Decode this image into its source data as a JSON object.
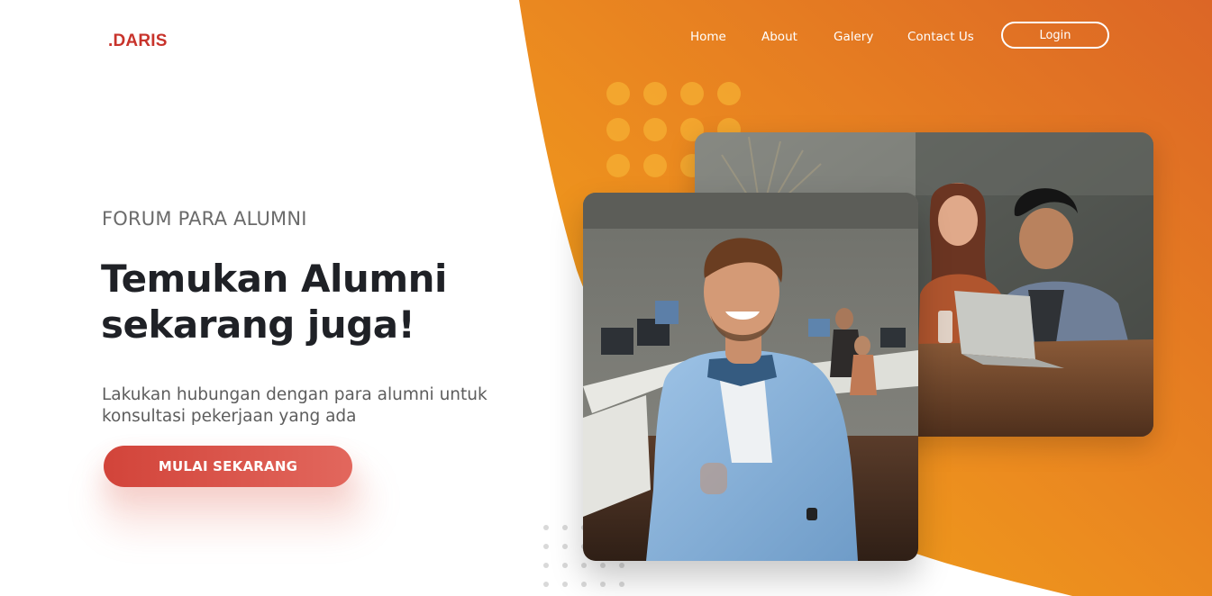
{
  "brand": {
    "logo": ".DARIS"
  },
  "nav": {
    "items": [
      "Home",
      "About",
      "Galery",
      "Contact Us"
    ],
    "login_label": "Login"
  },
  "hero": {
    "eyebrow": "FORUM PARA ALUMNI",
    "headline_line1": "Temukan Alumni",
    "headline_line2": "sekarang juga!",
    "description_line1": "Lakukan hubungan dengan para alumni untuk",
    "description_line2": "konsultasi pekerjaan yang ada",
    "cta_label": "MULAI SEKARANG"
  },
  "images": {
    "front": "photo-smiling-man-in-office",
    "back": "photo-two-people-laughing-at-laptop"
  },
  "colors": {
    "brand_red": "#c8332b",
    "orange_light": "#f0a21a",
    "orange_dark": "#dd6a24",
    "cta_start": "#d2443a",
    "cta_end": "#e2675d",
    "heading": "#1f2126",
    "body_text": "#5d5d5d"
  }
}
